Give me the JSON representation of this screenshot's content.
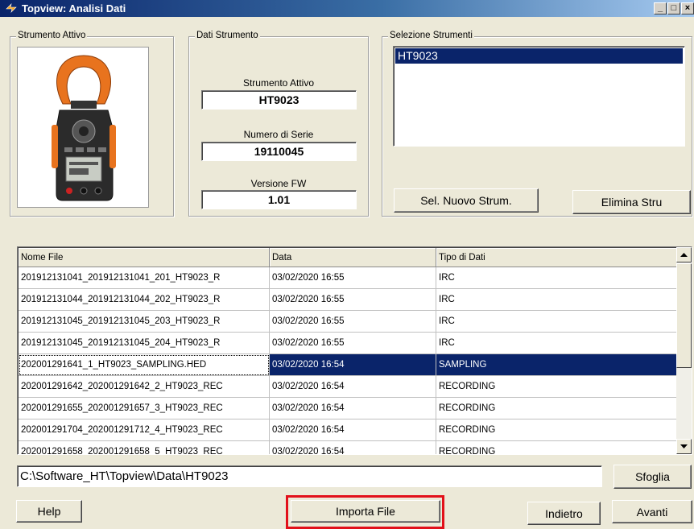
{
  "window": {
    "title": "Topview: Analisi Dati",
    "controls": {
      "minimize": "_",
      "maximize": "□",
      "close": "×"
    }
  },
  "strumento_attivo_group": {
    "label": "Strumento Attivo",
    "image_icon": "clamp-meter-icon"
  },
  "dati_strumento": {
    "label": "Dati Strumento",
    "fields": [
      {
        "label": "Strumento Attivo",
        "value": "HT9023"
      },
      {
        "label": "Numero di Serie",
        "value": "19110045"
      },
      {
        "label": "Versione FW",
        "value": "1.01"
      }
    ]
  },
  "selezione_strumenti": {
    "label": "Selezione Strumenti",
    "items": [
      "HT9023"
    ],
    "selected": "HT9023",
    "buttons": {
      "sel_nuovo": "Sel. Nuovo Strum.",
      "elimina": "Elimina Stru"
    }
  },
  "file_table": {
    "columns": [
      "Nome File",
      "Data",
      "Tipo di Dati"
    ],
    "rows": [
      [
        "201912131041_201912131041_201_HT9023_R",
        "03/02/2020 16:55",
        "IRC"
      ],
      [
        "201912131044_201912131044_202_HT9023_R",
        "03/02/2020 16:55",
        "IRC"
      ],
      [
        "201912131045_201912131045_203_HT9023_R",
        "03/02/2020 16:55",
        "IRC"
      ],
      [
        "201912131045_201912131045_204_HT9023_R",
        "03/02/2020 16:55",
        "IRC"
      ],
      [
        "202001291641_1_HT9023_SAMPLING.HED",
        "03/02/2020 16:54",
        "SAMPLING"
      ],
      [
        "202001291642_202001291642_2_HT9023_REC",
        "03/02/2020 16:54",
        "RECORDING"
      ],
      [
        "202001291655_202001291657_3_HT9023_REC",
        "03/02/2020 16:54",
        "RECORDING"
      ],
      [
        "202001291704_202001291712_4_HT9023_REC",
        "03/02/2020 16:54",
        "RECORDING"
      ],
      [
        "202001291658_202001291658_5_HT9023_REC",
        "03/02/2020 16:54",
        "RECORDING"
      ]
    ],
    "selected_row": 4
  },
  "path": {
    "value": "C:\\Software_HT\\Topview\\Data\\HT9023"
  },
  "buttons": {
    "sfoglia": "Sfoglia",
    "help": "Help",
    "importa": "Importa File",
    "indietro": "Indietro",
    "avanti": "Avanti"
  },
  "colors": {
    "selection": "#0a246a",
    "highlight": "#e2101a",
    "face": "#ece9d8",
    "meter_orange": "#e8731e"
  }
}
